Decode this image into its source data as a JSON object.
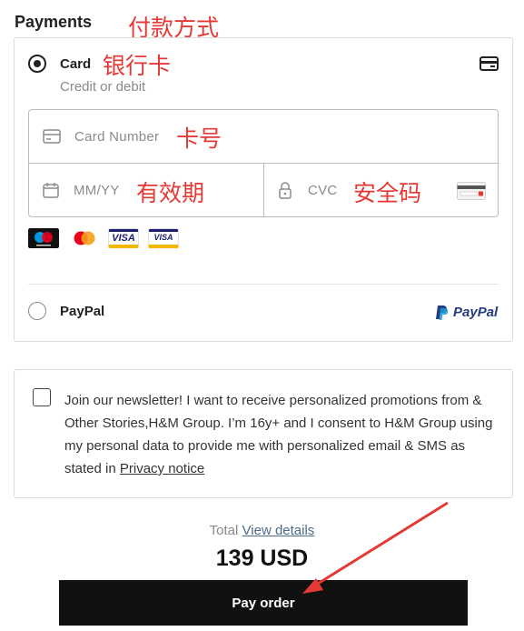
{
  "section": {
    "title": "Payments"
  },
  "annotations": {
    "payment_method": "付款方式",
    "bank_card": "银行卡",
    "card_number": "卡号",
    "expiry": "有效期",
    "security_code": "安全码"
  },
  "payment": {
    "card": {
      "label": "Card",
      "sublabel": "Credit or debit",
      "selected": true,
      "card_number_placeholder": "Card Number",
      "expiry_placeholder": "MM/YY",
      "cvc_placeholder": "CVC",
      "accepted_cards": [
        "maestro-icon",
        "mastercard-icon",
        "visa-icon",
        "visa-electron-icon"
      ],
      "visa_text": "VISA"
    },
    "paypal": {
      "label": "PayPal",
      "selected": false,
      "logo_text": "PayPal"
    }
  },
  "newsletter": {
    "checked": false,
    "text": "Join our newsletter! I want to receive personalized promotions from & Other Stories,H&M Group. I’m 16y+ and I consent to H&M Group using my personal data to provide me with personalized email & SMS as stated in ",
    "link_text": "Privacy notice"
  },
  "summary": {
    "total_label": "Total",
    "view_details": "View details",
    "amount": "139 USD"
  },
  "button": {
    "pay_label": "Pay order"
  },
  "colors": {
    "annotation": "#e53935",
    "button_bg": "#111111",
    "paypal_dark": "#253b80",
    "paypal_light": "#179bd7"
  }
}
